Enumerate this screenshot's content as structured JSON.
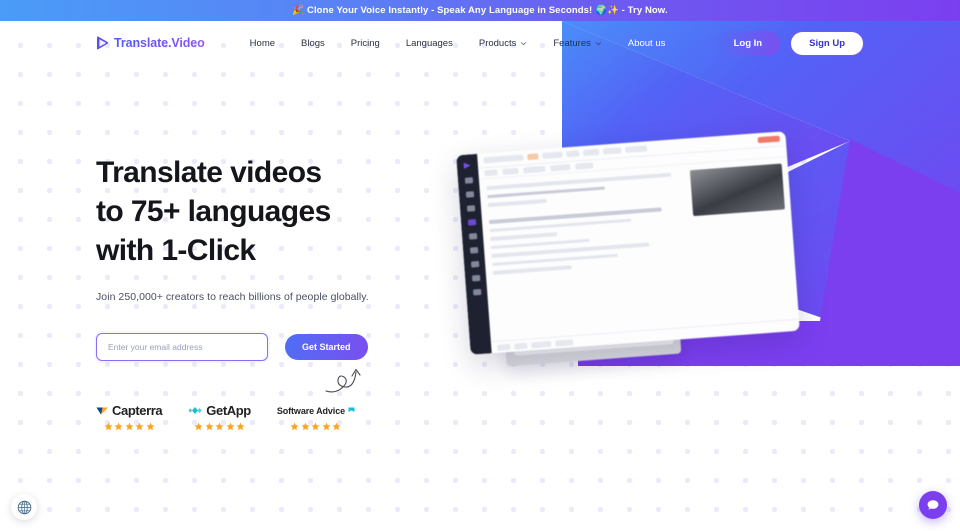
{
  "announcement": {
    "text": "🎉 Clone Your Voice Instantly - Speak Any Language in Seconds! 🌍✨ - Try Now."
  },
  "header": {
    "logo_text": "Translate.Video",
    "logo_icon": "play-triangle-icon",
    "nav": [
      {
        "label": "Home",
        "has_dropdown": false
      },
      {
        "label": "Blogs",
        "has_dropdown": false
      },
      {
        "label": "Pricing",
        "has_dropdown": false
      },
      {
        "label": "Languages",
        "has_dropdown": false
      },
      {
        "label": "Products",
        "has_dropdown": true
      },
      {
        "label": "Features",
        "has_dropdown": true
      },
      {
        "label": "About us",
        "has_dropdown": false
      }
    ],
    "login_label": "Log In",
    "signup_label": "Sign Up"
  },
  "hero": {
    "headline_line1": "Translate videos",
    "headline_line2": "to 75+ languages",
    "headline_line3": "with 1-Click",
    "subheadline": "Join 250,000+ creators to reach billions of people globally.",
    "email_placeholder": "Enter your email address",
    "email_value": "",
    "cta_label": "Get Started"
  },
  "badges": [
    {
      "name": "Capterra",
      "icon": "capterra-arrow-icon",
      "stars": 5
    },
    {
      "name": "GetApp",
      "icon": "getapp-diamond-icon",
      "stars": 5
    },
    {
      "name": "Software Advice",
      "icon": "software-advice-flag-icon",
      "stars": 5
    }
  ],
  "widgets": {
    "language_icon": "globe-icon",
    "chat_icon": "chat-bubble-icon"
  },
  "colors": {
    "brand_purple": "#7b3ff0",
    "brand_blue": "#4f6ef5",
    "banner_blue": "#4a9cf8",
    "star_orange": "#f5a623",
    "dark_text": "#15161c",
    "dot_grid": "#e9ebfa"
  }
}
